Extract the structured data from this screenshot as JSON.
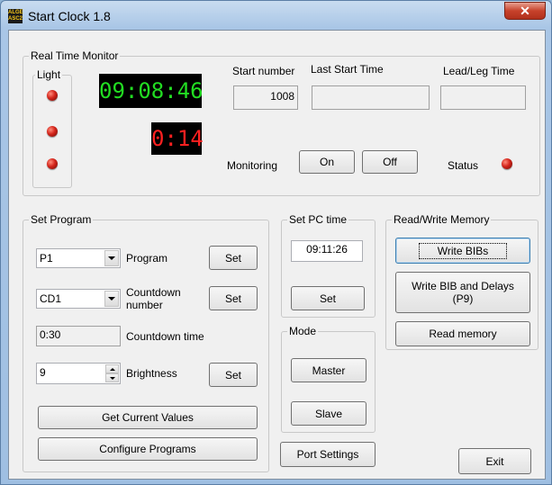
{
  "window": {
    "title": "Start Clock 1.8",
    "icon_text": "ALGE ASC2"
  },
  "close_glyph": "✕",
  "monitor": {
    "group_label": "Real Time Monitor",
    "light_label": "Light",
    "clock_time": "09:08:46",
    "clock_countdown": "0:14",
    "start_number_label": "Start number",
    "start_number_value": "1008",
    "last_start_label": "Last Start Time",
    "last_start_value": "",
    "lead_label": "Lead/Leg Time",
    "lead_value": "",
    "monitoring_label": "Monitoring",
    "on_label": "On",
    "off_label": "Off",
    "status_label": "Status"
  },
  "set_program": {
    "group_label": "Set Program",
    "program_value": "P1",
    "program_label": "Program",
    "countdown_value": "CD1",
    "countdown_label": "Countdown number",
    "countdown_time_value": "0:30",
    "countdown_time_label": "Countdown time",
    "brightness_value": "9",
    "brightness_label": "Brightness",
    "set_label": "Set",
    "get_current_label": "Get Current Values",
    "configure_label": "Configure Programs"
  },
  "pc_time": {
    "group_label": "Set PC time",
    "value": "09:11:26",
    "set_label": "Set"
  },
  "mode": {
    "group_label": "Mode",
    "master_label": "Master",
    "slave_label": "Slave"
  },
  "port_settings_label": "Port Settings",
  "memory": {
    "group_label": "Read/Write Memory",
    "write_bibs_label": "Write BIBs",
    "write_bib_delays_label": "Write BIB and Delays (P9)",
    "read_memory_label": "Read memory"
  },
  "exit_label": "Exit",
  "colors": {
    "clock_green": "#22dd22",
    "clock_red": "#ff2020",
    "led_red": "#d3241a"
  }
}
